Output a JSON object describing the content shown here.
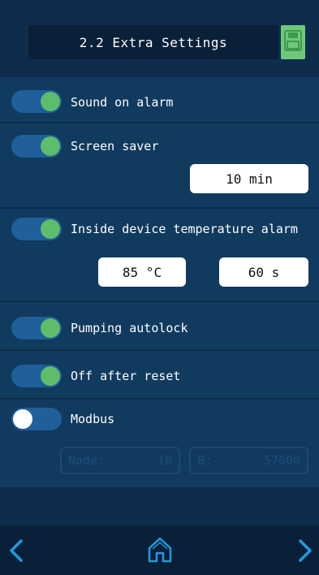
{
  "header": {
    "title": "2.2 Extra Settings",
    "save_icon": "floppy-disk-icon"
  },
  "settings": {
    "sound_on_alarm": {
      "label": "Sound on alarm",
      "enabled": true
    },
    "screen_saver": {
      "label": "Screen saver",
      "enabled": true,
      "value": "10 min"
    },
    "temp_alarm": {
      "label": "Inside device temperature alarm",
      "enabled": true,
      "temp_value": "85 °C",
      "time_value": "60 s"
    },
    "pumping_autolock": {
      "label": "Pumping autolock",
      "enabled": true
    },
    "off_after_reset": {
      "label": "Off after reset",
      "enabled": true
    },
    "modbus": {
      "label": "Modbus",
      "enabled": false,
      "node_label": "Node:",
      "node_value": "10",
      "baud_label": "B:",
      "baud_value": "57600"
    }
  },
  "footer": {
    "back_icon": "chevron-left-icon",
    "home_icon": "home-icon",
    "next_icon": "chevron-right-icon"
  },
  "colors": {
    "accent_green": "#5dbd6b",
    "toggle_track": "#1f5f9a",
    "background": "#113a5f"
  }
}
